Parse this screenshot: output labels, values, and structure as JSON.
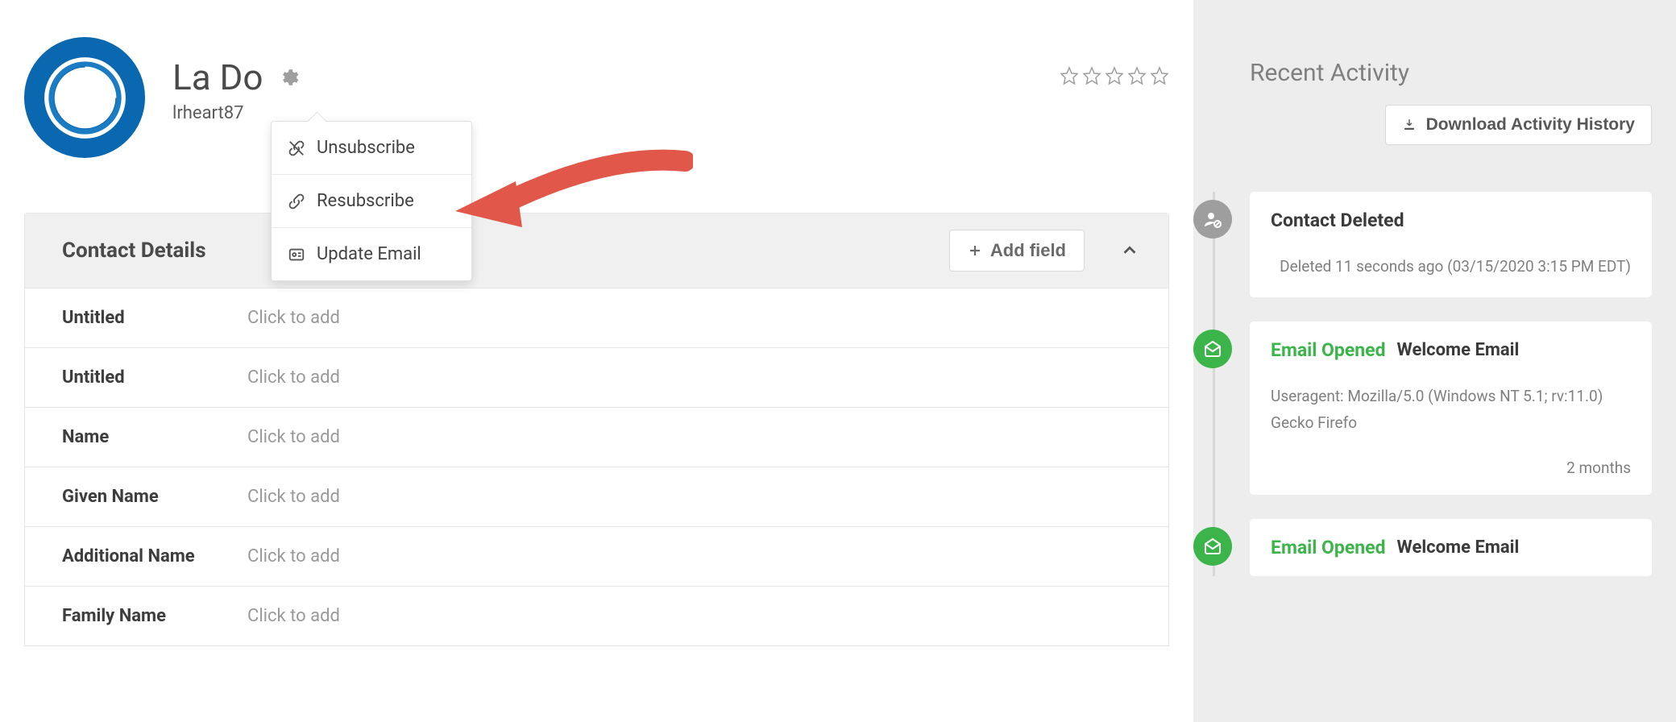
{
  "contact": {
    "name": "La Do",
    "email_truncated": "lrheart87"
  },
  "menu": {
    "unsubscribe": "Unsubscribe",
    "resubscribe": "Resubscribe",
    "update_email": "Update Email"
  },
  "details": {
    "title": "Contact Details",
    "add_field": "Add field",
    "placeholder": "Click to add",
    "fields": [
      {
        "label": "Untitled"
      },
      {
        "label": "Untitled"
      },
      {
        "label": "Name"
      },
      {
        "label": "Given Name"
      },
      {
        "label": "Additional Name"
      },
      {
        "label": "Family Name"
      }
    ]
  },
  "sidebar": {
    "title": "Recent Activity",
    "download": "Download Activity History"
  },
  "activities": [
    {
      "kind": "deleted",
      "title": "Contact Deleted",
      "body": "Deleted 11 seconds ago (03/15/2020 3:15 PM EDT)"
    },
    {
      "kind": "opened",
      "title": "Email Opened",
      "subject": "Welcome Email",
      "body": "Useragent: Mozilla/5.0 (Windows NT 5.1; rv:11.0) Gecko Firefo",
      "footer": "2 months"
    },
    {
      "kind": "opened",
      "title": "Email Opened",
      "subject": "Welcome Email"
    }
  ]
}
